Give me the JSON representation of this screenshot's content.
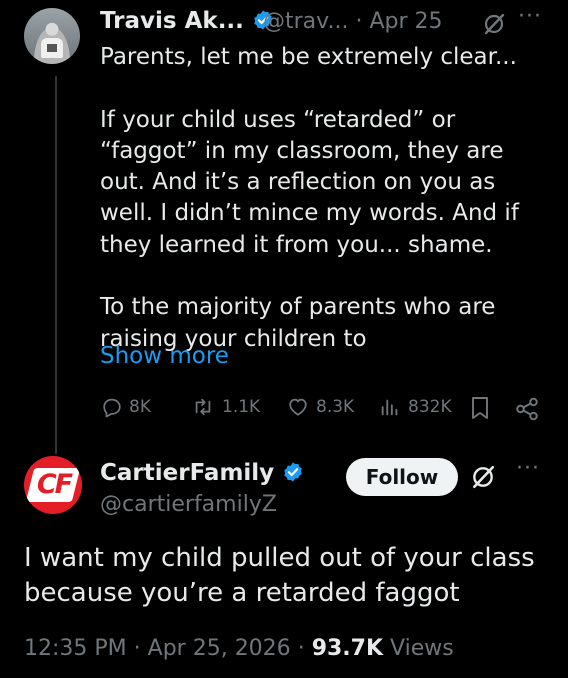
{
  "tweet": {
    "author_name": "Travis Ak...",
    "handle": "@trav...",
    "separator": "·",
    "date": "Apr 25",
    "more": "···",
    "text": "Parents, let me be extremely clear...\n\nIf your child uses “retarded” or\n“faggot” in my classroom, they are\nout. And it’s a reflection on you as\nwell. I didn’t mince my words. And if\nthey learned it from you... shame.\n\nTo the majority of parents who are\nraising your children to",
    "show_more": "Show more",
    "replies": "8K",
    "reposts": "1.1K",
    "likes": "8.3K",
    "views": "832K"
  },
  "reply": {
    "author_name": "CartierFamily",
    "handle": "@cartierfamilyZ",
    "avatar_text": "CF",
    "follow_label": "Follow",
    "more": "···",
    "text": "I want my child pulled out of your class because you’re a retarded faggot",
    "time": "12:35 PM",
    "separator": "·",
    "date": "Apr 25, 2026",
    "separator2": "·",
    "views_count": "93.7K",
    "views_label": "Views"
  },
  "colors": {
    "background": "#000000",
    "text": "#e7e9ea",
    "muted": "#71767b",
    "link": "#1d9bf0",
    "verified": "#1d9bf0",
    "brand_red": "#e41e26"
  }
}
